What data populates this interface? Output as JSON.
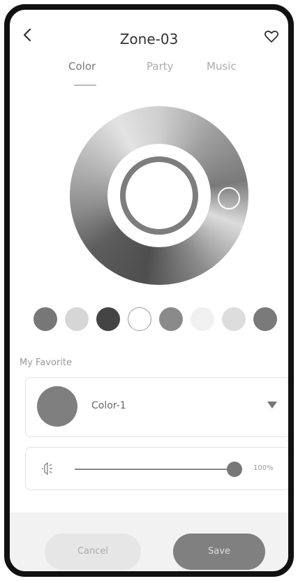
{
  "header": {
    "title": "Zone-03"
  },
  "tabs": [
    {
      "label": "Color",
      "active": true
    },
    {
      "label": "Party",
      "active": false
    },
    {
      "label": "Music",
      "active": false
    }
  ],
  "wheel": {
    "ring_color": "#7d7d7d"
  },
  "swatches": [
    "#777777",
    "#d6d6d6",
    "#444444",
    "#ffffff",
    "#8a8a8a",
    "#f0f0f0",
    "#dddddd",
    "#7a7a7a"
  ],
  "favorites": {
    "label": "My Favorite",
    "selected_name": "Color-1",
    "selected_color": "#7f7f7f"
  },
  "brightness": {
    "value_label": "100%",
    "level": 1.0
  },
  "actions": {
    "cancel_label": "Cancel",
    "save_label": "Save"
  }
}
